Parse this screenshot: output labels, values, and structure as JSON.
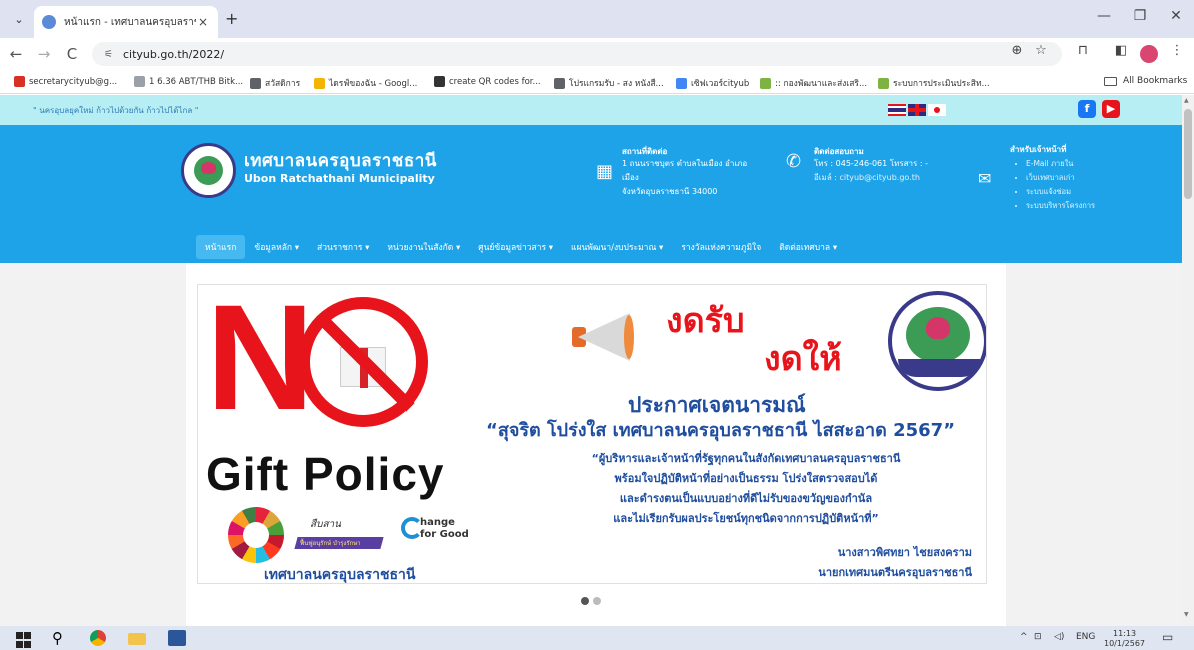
{
  "browser": {
    "tab_title": "หน้าแรก - เทศบาลนครอุบลราชธานี",
    "new_tab_label": "+",
    "tab_close_label": "×",
    "url": "cityub.go.th/2022/",
    "back_label": "←",
    "forward_label": "→",
    "reload_label": "C",
    "bookmarks": [
      {
        "label": "secretarycityub@g...",
        "color": "#d93025"
      },
      {
        "label": "1 6.36 ABT/THB Bitk...",
        "color": "#9aa0a6"
      },
      {
        "label": "สวัสดิการ",
        "color": "#5f6368"
      },
      {
        "label": "ไดรฟ์ของฉัน - Googl...",
        "color": "#f4b400"
      },
      {
        "label": "create QR codes for...",
        "color": "#333333"
      },
      {
        "label": "โปรแกรมรับ - สง หนังสื...",
        "color": "#5f6368"
      },
      {
        "label": "เซิฟเวอร์cityub",
        "color": "#4285f4"
      },
      {
        "label": ":: กองพัฒนาและส่งเสริ...",
        "color": "#7cb342"
      },
      {
        "label": "ระบบการประเมินประสิท...",
        "color": "#7cb342"
      }
    ],
    "all_bookmarks_label": "All Bookmarks"
  },
  "site": {
    "slogan": "\" นครอุบลยุคใหม่ ก้าวไปด้วยกัน ก้าวไปได้ไกล \"",
    "name_th": "เทศบาลนครอุบลราชธานี",
    "name_en": "Ubon Ratchathani Municipality",
    "contact_title": "สถานที่ติดต่อ",
    "contact_address_1": "1 ถนนราชบุตร ตำบลในเมือง อำเภอ",
    "contact_address_2": "เมือง",
    "contact_address_3": "จังหวัดอุบลราชธานี 34000",
    "inquiry_title": "ติดต่อสอบถาม",
    "phone_line": "โทร : 045-246-061 โทรสาร : -",
    "email_line": "อีเมล์ : cityub@cityub.go.th",
    "officer_title": "สำหรับเจ้าหน้าที่",
    "officer_links": [
      "E-Mail ภายใน",
      "เว็บเทศบาลเก่า",
      "ระบบแจ้งซ่อม",
      "ระบบบริหารโครงการ"
    ],
    "facebook_label": "f",
    "youtube_label": "▶"
  },
  "nav": {
    "items": [
      {
        "label": "หน้าแรก",
        "active": true
      },
      {
        "label": "ข้อมูลหลัก ▾",
        "active": false
      },
      {
        "label": "ส่วนราชการ ▾",
        "active": false
      },
      {
        "label": "หน่วยงานในสังกัด ▾",
        "active": false
      },
      {
        "label": "ศูนย์ข้อมูลข่าวสาร ▾",
        "active": false
      },
      {
        "label": "แผนพัฒนา/งบประมาณ ▾",
        "active": false
      },
      {
        "label": "รางวัลแห่งความภูมิใจ",
        "active": false
      },
      {
        "label": "ติดต่อเทศบาล ▾",
        "active": false
      }
    ]
  },
  "banner": {
    "big_letter": "N",
    "gift_policy": "Gift  Policy",
    "headline_1": "งดรับ",
    "headline_2": "งดให้",
    "pledge_title": "ประกาศเจตนารมณ์",
    "pledge_quote": "“สุจริต โปร่งใส เทศบาลนครอุบลราชธานี ไสสะอาด 2567”",
    "pledge_lines": [
      "“ผู้บริหารและเจ้าหน้าที่รัฐทุกคนในสังกัดเทศบาลนครอุบลราชธานี",
      "พร้อมใจปฏิบัติหน้าที่อย่างเป็นธรรม โปร่งใสตรวจสอบได้",
      "และดำรงตนเป็นแบบอย่างที่ดีไม่รับของขวัญของกำนัล",
      "และไม่เรียกรับผลประโยชน์ทุกชนิดจากการปฏิบัติหน้าที่”"
    ],
    "signer_name": "นางสาวพิศทยา ไชยสงคราม",
    "signer_position": "นายกเทศมนตรีนครอุบลราชธานี",
    "municipality": "เทศบาลนครอุบลราชธานี",
    "change_for_good": "hange\nfor Good",
    "sig_script": "สืบสาน",
    "sig_caption": "ฟื้นฟูอนุรักษ์ บำรุงรักษา",
    "slide_count": 2,
    "active_slide": 1
  },
  "taskbar": {
    "language": "ENG",
    "time": "11:13",
    "date": "10/1/2567"
  }
}
